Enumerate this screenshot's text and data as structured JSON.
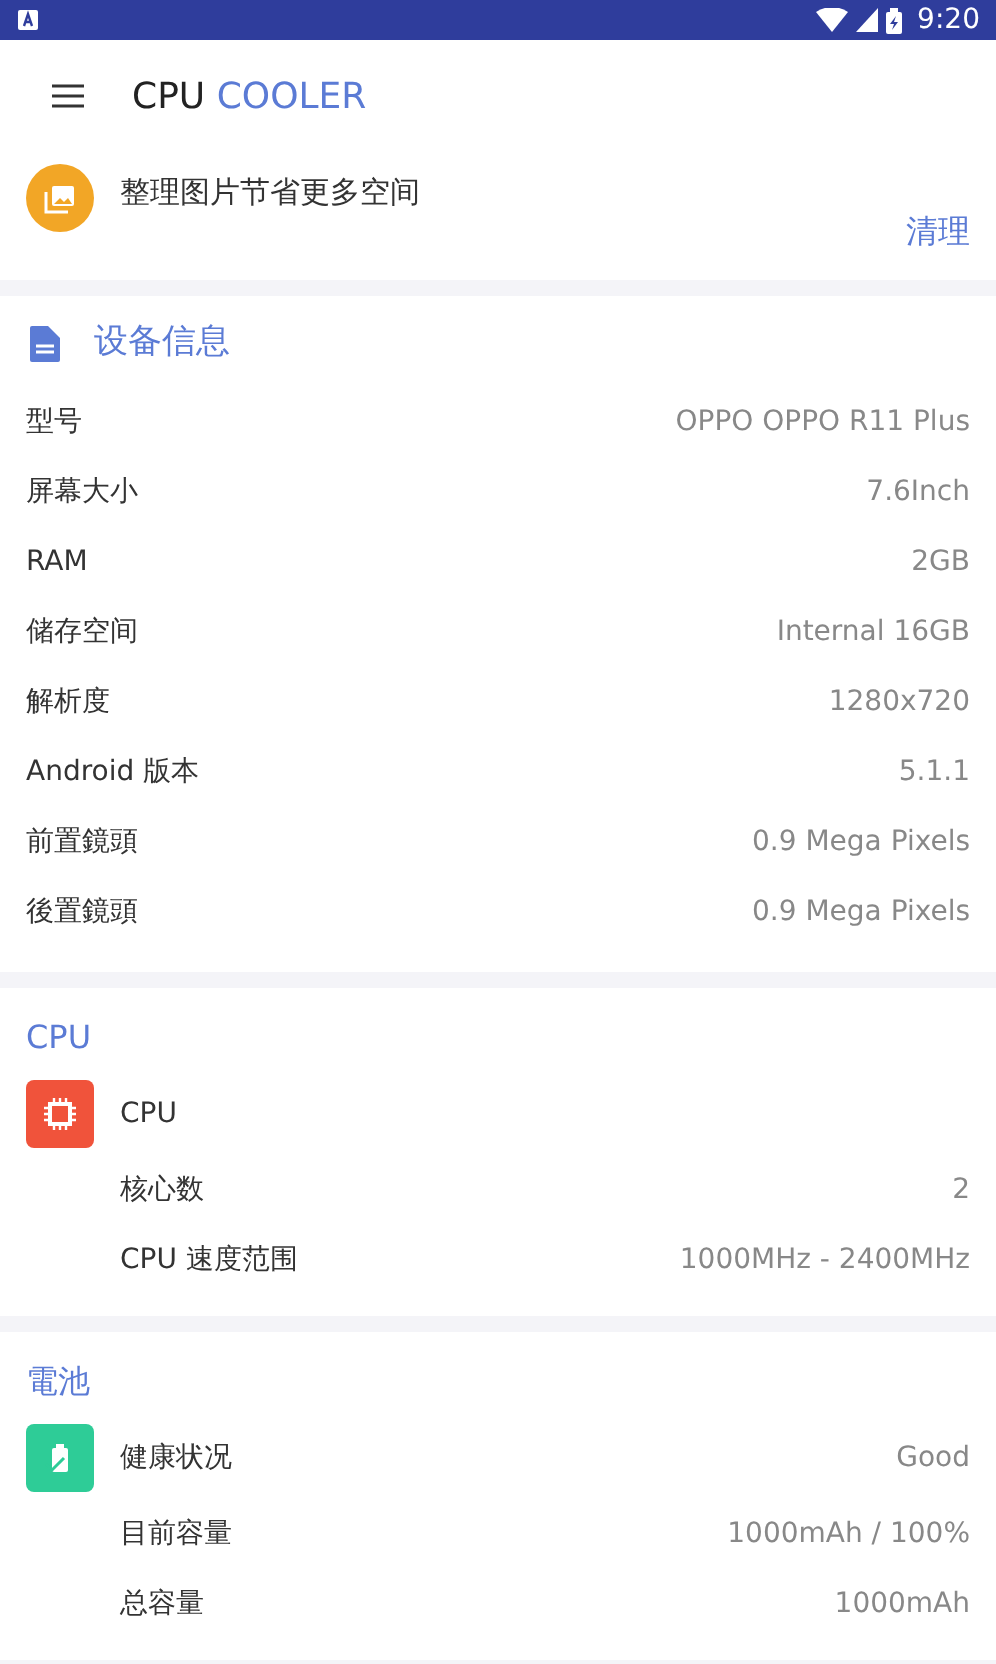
{
  "status_bar": {
    "time": "9:20"
  },
  "toolbar": {
    "title_part_1": "CPU",
    "title_part_2": "COOLER"
  },
  "banner": {
    "message": "整理图片节省更多空间",
    "action": "清理"
  },
  "device_info": {
    "title": "设备信息",
    "rows": [
      {
        "label": "型号",
        "value": "OPPO OPPO R11 Plus"
      },
      {
        "label": "屏幕大小",
        "value": "7.6Inch"
      },
      {
        "label": "RAM",
        "value": "2GB"
      },
      {
        "label": "储存空间",
        "value": "Internal 16GB"
      },
      {
        "label": "解析度",
        "value": "1280x720"
      },
      {
        "label": "Android 版本",
        "value": "5.1.1"
      },
      {
        "label": "前置鏡頭",
        "value": "0.9 Mega Pixels"
      },
      {
        "label": "後置鏡頭",
        "value": "0.9 Mega Pixels"
      }
    ]
  },
  "sections": [
    {
      "title": "CPU",
      "kind": "cpu",
      "heading": "CPU",
      "rows": [
        {
          "label": "核心数",
          "value": "2"
        },
        {
          "label": "CPU 速度范围",
          "value": "1000MHz - 2400MHz"
        }
      ]
    },
    {
      "title": "電池",
      "kind": "battery",
      "heading": "健康状况",
      "heading_value": "Good",
      "rows": [
        {
          "label": "目前容量",
          "value": "1000mAh / 100%"
        },
        {
          "label": "总容量",
          "value": "1000mAh"
        }
      ]
    }
  ]
}
